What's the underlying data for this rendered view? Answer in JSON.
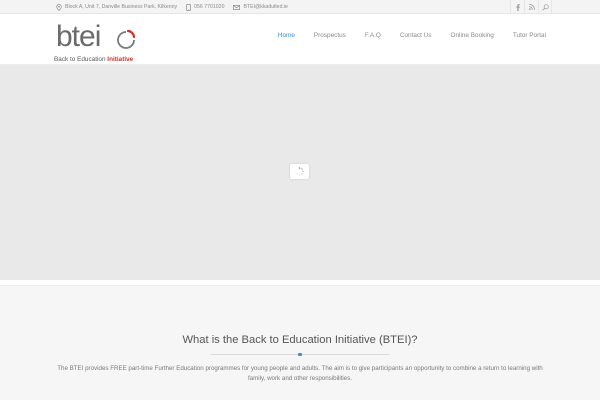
{
  "topbar": {
    "address": "Block A, Unit 7, Danville Business Park, Kilkenny",
    "phone": "056 7701020",
    "email": "BTEI@kkadulted.ie",
    "social_icons": [
      "facebook-icon",
      "rss-icon",
      "search-icon"
    ]
  },
  "logo": {
    "wordmark": "btei",
    "tagline_prefix": "Back to Education ",
    "tagline_emphasis": "Initiative",
    "accent_color": "#c8352c"
  },
  "nav": {
    "items": [
      {
        "label": "Home",
        "active": true
      },
      {
        "label": "Prospectus",
        "active": false
      },
      {
        "label": "F.A.Q",
        "active": false
      },
      {
        "label": "Contact Us",
        "active": false
      },
      {
        "label": "Online Booking",
        "active": false
      },
      {
        "label": "Tutor Portal",
        "active": false
      }
    ],
    "active_color": "#3b8fd5"
  },
  "intro": {
    "heading": "What is the Back to Education Initiative (BTEI)?",
    "body": "The BTEI provides FREE part-time Further Education programmes for young people and adults. The aim is to give participants an opportunity to combine a return to learning with family, work and other responsibilities."
  }
}
